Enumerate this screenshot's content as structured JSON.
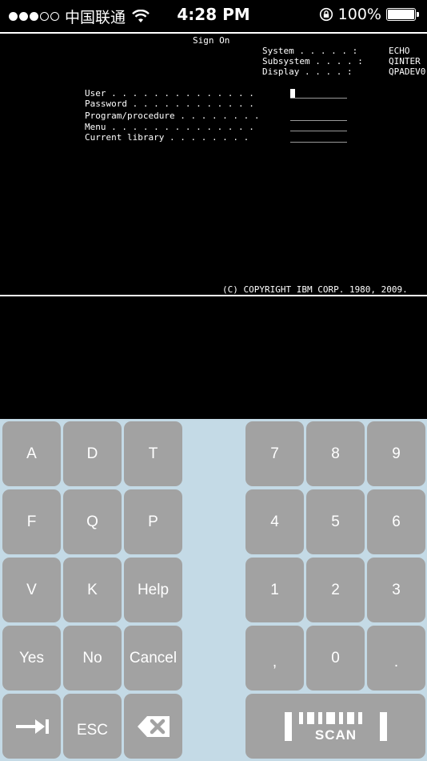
{
  "status_bar": {
    "carrier": "中国联通",
    "time": "4:28 PM",
    "battery": "100%"
  },
  "terminal": {
    "title": "Sign On",
    "system_label": "System . . . . . :",
    "system_value": "ECHO",
    "subsystem_label": "Subsystem . . . . :",
    "subsystem_value": "QINTER",
    "display_label": "Display . . . . :",
    "display_value": "QPADEV0",
    "fields": [
      {
        "label": "User . . . . . . . . . . . . . ."
      },
      {
        "label": "Password . . . . . . . . . . . ."
      },
      {
        "label": "Program/procedure . . . . . . . ."
      },
      {
        "label": "Menu . . . . . . . . . . . . . ."
      },
      {
        "label": "Current library . . . . . . . ."
      }
    ],
    "copyright": "(C) COPYRIGHT IBM CORP. 1980, 2009."
  },
  "keyboard": {
    "left_keys": [
      "A",
      "D",
      "T",
      "F",
      "Q",
      "P",
      "V",
      "K",
      "Help",
      "Yes",
      "No",
      "Cancel"
    ],
    "right_keys": [
      "7",
      "8",
      "9",
      "4",
      "5",
      "6",
      "1",
      "2",
      "3",
      ",",
      "0",
      "."
    ],
    "tab_icon": "tab-arrow-icon",
    "esc": "ESC",
    "backspace_icon": "backspace-icon",
    "scan_label": "SCAN"
  }
}
